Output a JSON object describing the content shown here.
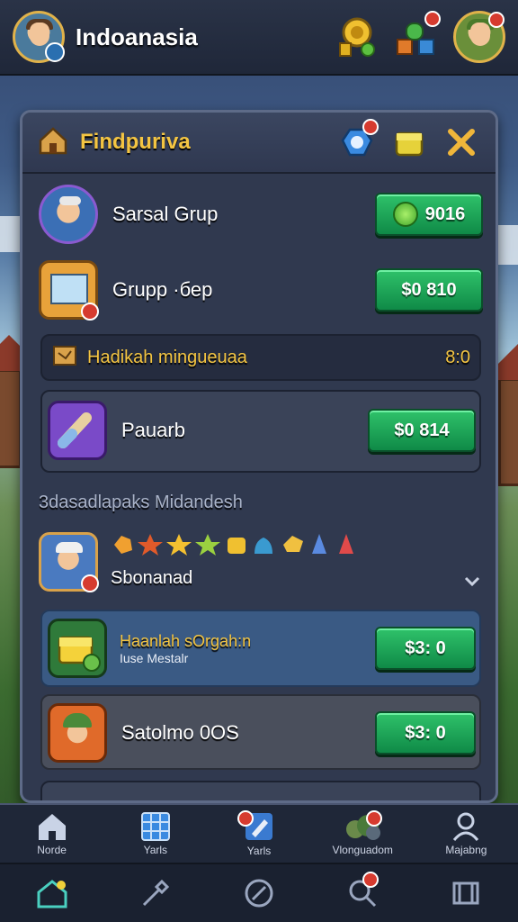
{
  "header": {
    "title": "Indoanasia",
    "icons": [
      "coin-stack-icon",
      "blocks-icon",
      "player-avatar-icon"
    ]
  },
  "panel": {
    "title": "Findpuriva",
    "header_icons": [
      "gem-icon",
      "chest-icon",
      "close-icon"
    ]
  },
  "rows": [
    {
      "label": "Sarsal Grup",
      "price": "9016",
      "icon": "character-portrait-icon"
    },
    {
      "label": "Grupp ·бер",
      "price": "$0 810",
      "icon": "map-scroll-icon"
    },
    {
      "label": "Pauarb",
      "price": "$0 814",
      "icon": "purple-scroll-icon"
    }
  ],
  "banner": {
    "label": "Hadikah mingueuaa",
    "value": "8:0",
    "icon": "treasure-map-icon"
  },
  "section": {
    "title": "3dasadlapaks Midandesh",
    "row_label": "Sbonanad",
    "gems": [
      "orange-gem",
      "red-star",
      "gold-star",
      "green-star",
      "yellow-gem",
      "blue-drop",
      "gold-gem",
      "blue-shard",
      "red-shard"
    ]
  },
  "offers": [
    {
      "title": "Haanlah sOrgah:n",
      "subtitle": "Iuse Mestalr",
      "price": "$3: 0",
      "icon": "gold-chest-icon"
    },
    {
      "title": "Satolmo 0OS",
      "price": "$3: 0",
      "icon": "soldier-portrait-icon"
    }
  ],
  "nav_top": [
    {
      "label": "Norde",
      "icon": "home-icon"
    },
    {
      "label": "Yarls",
      "icon": "grid-icon"
    },
    {
      "label": "Yarls",
      "icon": "pencil-icon"
    },
    {
      "label": "Vlonguadom",
      "icon": "world-icon"
    },
    {
      "label": "Majabng",
      "icon": "profile-icon"
    }
  ],
  "nav_bottom": [
    "house-icon",
    "tools-icon",
    "compass-icon",
    "search-icon",
    "map-icon"
  ],
  "colors": {
    "accent": "#f4c542",
    "button": "#1fa557",
    "panel": "#30394f"
  }
}
